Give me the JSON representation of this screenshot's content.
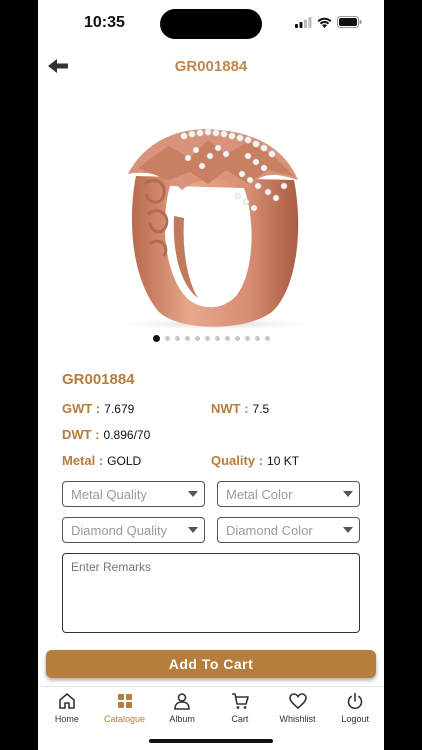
{
  "status_bar": {
    "time": "10:35"
  },
  "header": {
    "title": "GR001884"
  },
  "product": {
    "code": "GR001884",
    "image_dots_count": 12,
    "active_dot": 0,
    "gwt_label": "GWT :",
    "gwt_value": "7.679",
    "nwt_label": "NWT :",
    "nwt_value": "7.5",
    "dwt_label": "DWT :",
    "dwt_value": "0.896/70",
    "metal_label": "Metal :",
    "metal_value": "GOLD",
    "quality_label": "Quality :",
    "quality_value": "10 KT"
  },
  "form": {
    "metal_quality_placeholder": "Metal Quality",
    "metal_color_placeholder": "Metal Color",
    "diamond_quality_placeholder": "Diamond Quality",
    "diamond_color_placeholder": "Diamond Color",
    "remarks_placeholder": "Enter Remarks",
    "add_to_cart_label": "Add To Cart"
  },
  "tabs": [
    {
      "label": "Home",
      "icon": "home-icon"
    },
    {
      "label": "Catalogue",
      "icon": "grid-icon",
      "active": true
    },
    {
      "label": "Album",
      "icon": "user-icon"
    },
    {
      "label": "Cart",
      "icon": "cart-icon"
    },
    {
      "label": "Whishlist",
      "icon": "heart-icon"
    },
    {
      "label": "Logout",
      "icon": "power-icon"
    }
  ],
  "colors": {
    "accent": "#B57E3D",
    "title": "#C0874A"
  }
}
